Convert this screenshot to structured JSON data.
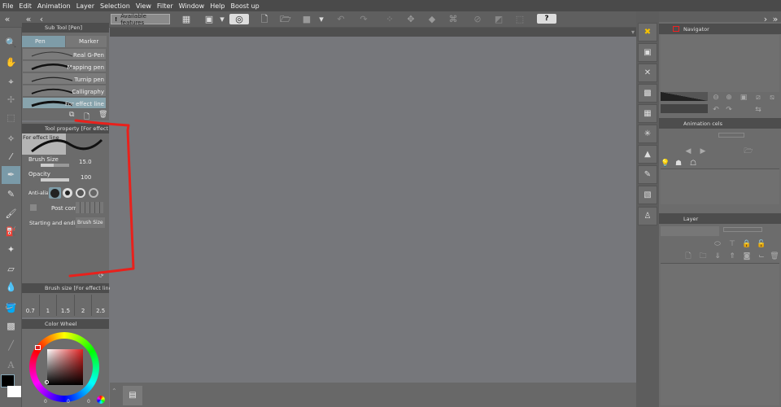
{
  "menu": [
    "File",
    "Edit",
    "Animation",
    "Layer",
    "Selection",
    "View",
    "Filter",
    "Window",
    "Help",
    "Boost up"
  ],
  "toolbar": {
    "available_features": "Available features",
    "help": "?"
  },
  "subtool": {
    "title": "Sub Tool [Pen]",
    "tabs": [
      "Pen",
      "Marker"
    ],
    "brushes": [
      "Real G-Pen",
      "Mapping pen",
      "Turnip pen",
      "Calligraphy",
      "For effect line"
    ],
    "selected": "For effect line"
  },
  "tool_property": {
    "title": "Tool property [For effect line]",
    "preview_label": "For effect line",
    "brush_size_label": "Brush Size",
    "brush_size_value": "15.0",
    "opacity_label": "Opacity",
    "opacity_value": "100",
    "anti_alias_label": "Anti-alias",
    "post_correction_label": "Post correction",
    "start_end_label": "Starting and ending",
    "start_end_value": "Brush Size"
  },
  "brush_size_panel": {
    "title": "Brush size [For effect line]",
    "sizes": [
      "0.7",
      "1",
      "1.5",
      "2",
      "2.5"
    ]
  },
  "color_wheel": {
    "title": "Color Wheel",
    "values": [
      "0",
      "0",
      "0"
    ],
    "main_color": "#000000",
    "sub_color": "#ffffff",
    "hue_color": "#e02020"
  },
  "navigator": {
    "title": "Navigator"
  },
  "animation_cels": {
    "title": "Animation cels"
  },
  "layer": {
    "title": "Layer"
  },
  "annotation_color": "#e8211c"
}
